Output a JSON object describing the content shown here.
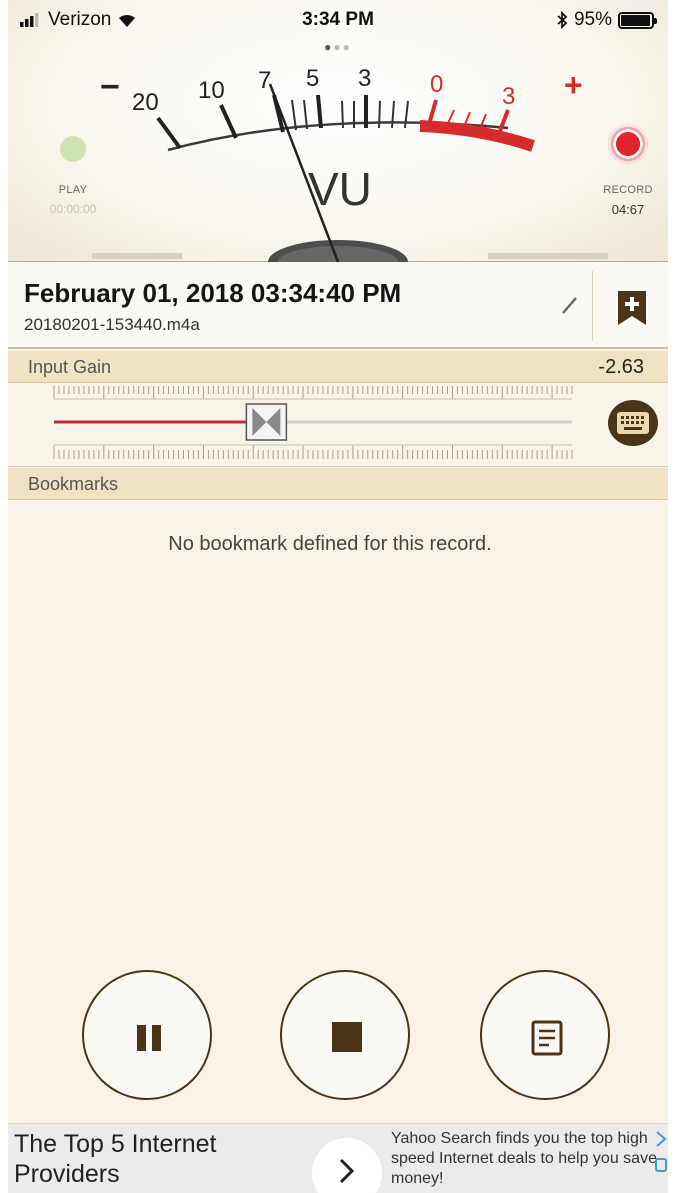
{
  "status_bar": {
    "carrier": "Verizon",
    "time": "3:34 PM",
    "battery": "95%"
  },
  "meter": {
    "scale_minus": "−",
    "scale_plus": "+",
    "scale_labels": [
      "20",
      "10",
      "7",
      "5",
      "3",
      "0",
      "3"
    ],
    "meter_name": "VU",
    "play": {
      "label": "PLAY",
      "time": "00:00:00"
    },
    "record": {
      "label": "RECORD",
      "time": "04:67"
    }
  },
  "recording": {
    "title": "February 01, 2018 03:34:40 PM",
    "filename": "20180201-153440.m4a"
  },
  "input_gain": {
    "label": "Input Gain",
    "value": "-2.63",
    "level": 0.41
  },
  "bookmarks": {
    "label": "Bookmarks",
    "empty_message": "No bookmark defined for this record."
  },
  "controls": [
    "pause",
    "stop",
    "notes"
  ],
  "ad": {
    "title": "The Top 5 Internet Providers",
    "body": "Yahoo Search finds you the top high speed Internet deals to help you save money!"
  },
  "colors": {
    "accent_red": "#d72b2b",
    "record_red": "#e0242a",
    "brown": "#4a3518",
    "section": "#efe3c4"
  }
}
